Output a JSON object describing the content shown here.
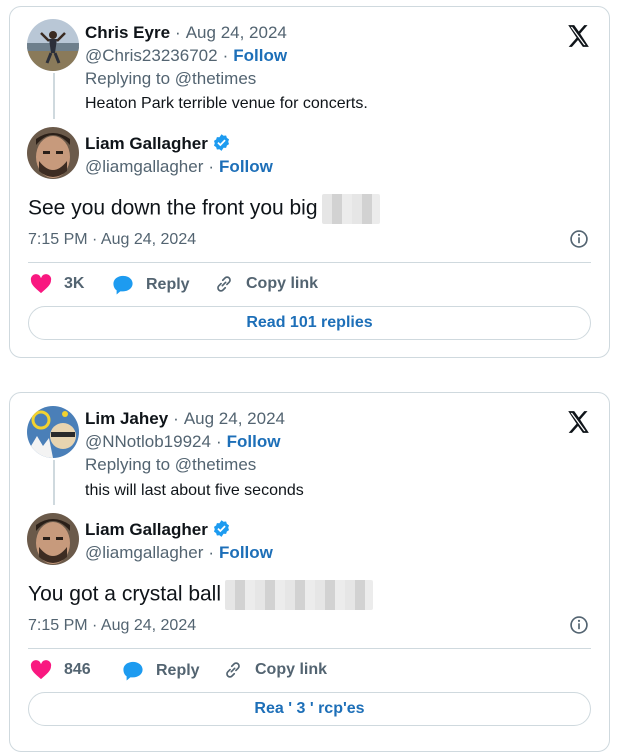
{
  "tweet1": {
    "parent": {
      "name": "Chris Eyre",
      "date": "Aug 24, 2024",
      "handle": "@Chris23236702",
      "follow": "Follow",
      "replying_to": "Replying to @thetimes",
      "text": "Heaton Park terrible venue for concerts."
    },
    "reply": {
      "name": "Liam Gallagher",
      "handle": "@liamgallagher",
      "follow": "Follow",
      "text": "See you down the front you big",
      "timestamp": "7:15 PM · Aug 24, 2024"
    },
    "actions": {
      "likes": "3K",
      "reply": "Reply",
      "copy_link": "Copy link"
    },
    "read_replies": "Read 101 replies"
  },
  "tweet2": {
    "parent": {
      "name": "Lim Jahey",
      "date": "Aug 24, 2024",
      "handle": "@NNotlob19924",
      "follow": "Follow",
      "replying_to": "Replying to @thetimes",
      "text": "this will last about five seconds"
    },
    "reply": {
      "name": "Liam Gallagher",
      "handle": "@liamgallagher",
      "follow": "Follow",
      "text": "You got a crystal ball",
      "timestamp": "7:15 PM · Aug 24, 2024"
    },
    "actions": {
      "likes": "846",
      "reply": "Reply",
      "copy_link": "Copy link"
    },
    "read_replies": "Rea ' 3 ' rcp'es"
  },
  "colors": {
    "like": "#f91880",
    "reply": "#1d9bf0",
    "link": "#1d6fb8",
    "verified": "#1d9bf0"
  },
  "icons": [
    "x-logo-icon",
    "verified-badge-icon",
    "info-icon",
    "heart-icon",
    "reply-bubble-icon",
    "link-icon"
  ]
}
